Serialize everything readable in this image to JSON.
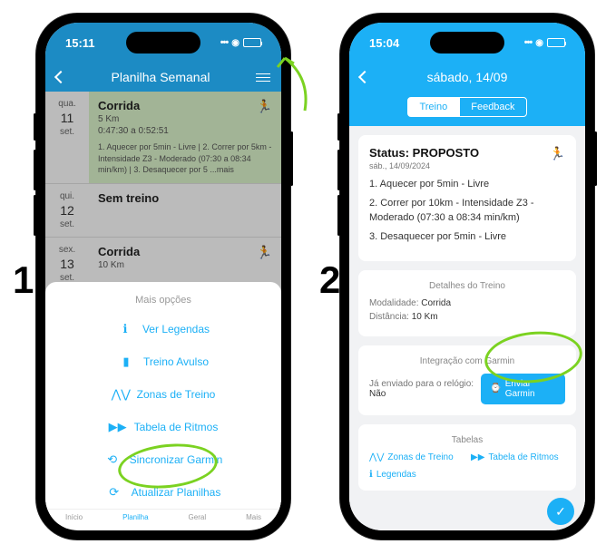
{
  "steps": {
    "one": "1",
    "two": "2"
  },
  "phone1": {
    "status": {
      "time": "15:11"
    },
    "header": {
      "title": "Planilha Semanal"
    },
    "days": [
      {
        "dow": "qua.",
        "num": "11",
        "mon": "set.",
        "title": "Corrida",
        "dist": "5 Km",
        "time": "0:47:30 a 0:52:51",
        "desc": "1. Aquecer por 5min - Livre | 2. Correr por 5km - Intensidade Z3 - Moderado (07:30 a 08:34 min/km) | 3. Desaquecer por 5 ...mais",
        "highlight": true
      },
      {
        "dow": "qui.",
        "num": "12",
        "mon": "set.",
        "title": "Sem treino"
      },
      {
        "dow": "sex.",
        "num": "13",
        "mon": "set.",
        "title": "Corrida",
        "dist": "10 Km"
      }
    ],
    "sheet": {
      "title": "Mais opções",
      "items": [
        {
          "icon": "ℹ",
          "label": "Ver Legendas"
        },
        {
          "icon": "▮",
          "label": "Treino Avulso"
        },
        {
          "icon": "⋀⋁",
          "label": "Zonas de Treino"
        },
        {
          "icon": "▶▶",
          "label": "Tabela de Ritmos"
        },
        {
          "icon": "⟲",
          "label": "Sincronizar Garmin"
        },
        {
          "icon": "⟳",
          "label": "Atualizar Planilhas"
        }
      ]
    },
    "tabbar": [
      "Início",
      "Planilha",
      "Geral",
      "Mais"
    ]
  },
  "phone2": {
    "status": {
      "time": "15:04"
    },
    "header": {
      "title": "sábado, 14/09"
    },
    "segments": {
      "a": "Treino",
      "b": "Feedback"
    },
    "status_card": {
      "title": "Status: PROPOSTO",
      "date": "sáb., 14/09/2024",
      "steps": [
        "1. Aquecer por 5min - Livre",
        "2. Correr por 10km - Intensidade Z3 - Moderado (07:30 a 08:34 min/km)",
        "3. Desaquecer por 5min - Livre"
      ]
    },
    "details": {
      "title": "Detalhes do Treino",
      "mod_label": "Modalidade: ",
      "mod_val": "Corrida",
      "dist_label": "Distância: ",
      "dist_val": "10 Km"
    },
    "garmin": {
      "title": "Integração com Garmin",
      "sent_label": "Já enviado para o relógio: ",
      "sent_val": "Não",
      "button": "Enviar Garmin"
    },
    "tables": {
      "title": "Tabelas",
      "links": [
        {
          "icon": "⋀⋁",
          "label": "Zonas de Treino"
        },
        {
          "icon": "▶▶",
          "label": "Tabela de Ritmos"
        },
        {
          "icon": "ℹ",
          "label": "Legendas"
        }
      ]
    }
  }
}
